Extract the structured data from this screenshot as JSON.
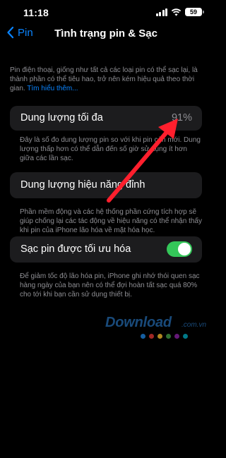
{
  "status_bar": {
    "time": "11:18",
    "battery_level": "59",
    "icons": [
      "signal-icon",
      "wifi-icon",
      "battery-icon"
    ]
  },
  "nav": {
    "back_label": "Pin",
    "title": "Tình trạng pin & Sạc"
  },
  "intro": {
    "text": "Pin điện thoại, giống như tất cả các loại pin có thể sạc lại, là thành phần có thể tiêu hao, trở nên kém hiệu quả theo thời gian. ",
    "link": "Tìm hiểu thêm..."
  },
  "max_capacity": {
    "label": "Dung lượng tối đa",
    "value": "91%",
    "footnote": "Đây là số đo dung lượng pin so với khi pin còn mới. Dung lượng thấp hơn có thể dẫn đến số giờ sử dụng ít hơn giữa các lần sạc."
  },
  "peak_performance": {
    "label": "Dung lượng hiệu năng đỉnh",
    "footnote": "Phần mềm động và các hệ thống phần cứng tích hợp sẽ giúp chống lại các tác động về hiệu năng có thể nhận thấy khi pin của iPhone lão hóa về mặt hóa học."
  },
  "optimized_charging": {
    "label": "Sạc pin được tối ưu hóa",
    "enabled": true,
    "footnote": "Để giảm tốc độ lão hóa pin, iPhone ghi nhớ thói quen sạc hàng ngày của bạn nên có thể đợi hoàn tất sạc quá 80% cho tới khi bạn cần sử dụng thiết bị."
  },
  "watermark": {
    "brand": "Download",
    "domain": ".com.vn",
    "dot_colors": [
      "#1e88e5",
      "#e53935",
      "#fbc02d",
      "#43a047",
      "#8e24aa",
      "#00acc1"
    ]
  },
  "colors": {
    "accent": "#0a84ff",
    "toggle_on": "#34c759",
    "annotation_arrow": "#ff1f2d",
    "cell_background": "#1c1c1e",
    "secondary_text": "#8e8e93"
  }
}
